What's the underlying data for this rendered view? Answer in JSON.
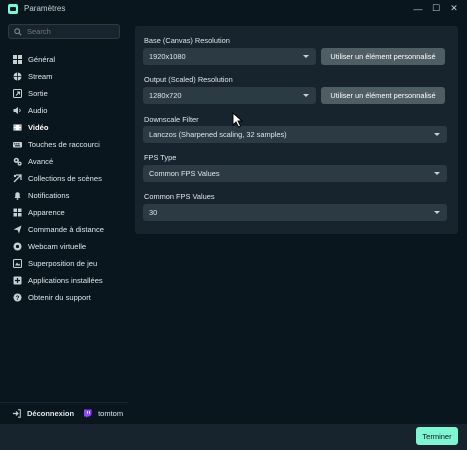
{
  "window": {
    "title": "Paramètres",
    "controls": {
      "minimize": "—",
      "maximize": "☐",
      "close": "✕"
    }
  },
  "search": {
    "placeholder": "Search",
    "value": ""
  },
  "nav": {
    "items": [
      {
        "label": "Général",
        "icon": "grid-icon",
        "active": false
      },
      {
        "label": "Stream",
        "icon": "globe-icon",
        "active": false
      },
      {
        "label": "Sortie",
        "icon": "output-icon",
        "active": false
      },
      {
        "label": "Audio",
        "icon": "speaker-icon",
        "active": false
      },
      {
        "label": "Vidéo",
        "icon": "film-icon",
        "active": true
      },
      {
        "label": "Touches de raccourci",
        "icon": "keyboard-icon",
        "active": false
      },
      {
        "label": "Avancé",
        "icon": "gears-icon",
        "active": false
      },
      {
        "label": "Collections de scènes",
        "icon": "collection-icon",
        "active": false
      },
      {
        "label": "Notifications",
        "icon": "bell-icon",
        "active": false
      },
      {
        "label": "Apparence",
        "icon": "appearance-icon",
        "active": false
      },
      {
        "label": "Commande à distance",
        "icon": "remote-icon",
        "active": false
      },
      {
        "label": "Webcam virtuelle",
        "icon": "webcam-icon",
        "active": false
      },
      {
        "label": "Superposition de jeu",
        "icon": "overlay-icon",
        "active": false
      },
      {
        "label": "Applications installées",
        "icon": "apps-icon",
        "active": false
      },
      {
        "label": "Obtenir du support",
        "icon": "help-icon",
        "active": false
      }
    ]
  },
  "footer": {
    "logout_label": "Déconnexion",
    "username": "tomtom"
  },
  "video": {
    "base_label": "Base (Canvas) Resolution",
    "base_value": "1920x1080",
    "base_custom_button": "Utiliser un élément personnalisé",
    "output_label": "Output (Scaled) Resolution",
    "output_value": "1280x720",
    "output_custom_button": "Utiliser un élément personnalisé",
    "filter_label": "Downscale Filter",
    "filter_value": "Lanczos (Sharpened scaling, 32 samples)",
    "fps_type_label": "FPS Type",
    "fps_type_value": "Common FPS Values",
    "fps_values_label": "Common FPS Values",
    "fps_values_value": "30"
  },
  "done_button": "Terminer",
  "colors": {
    "background": "#09161d",
    "panel": "#17242d",
    "input": "#2b3a43",
    "button": "#4f5e65",
    "accent": "#80f5d2",
    "twitch": "#9146ff"
  }
}
